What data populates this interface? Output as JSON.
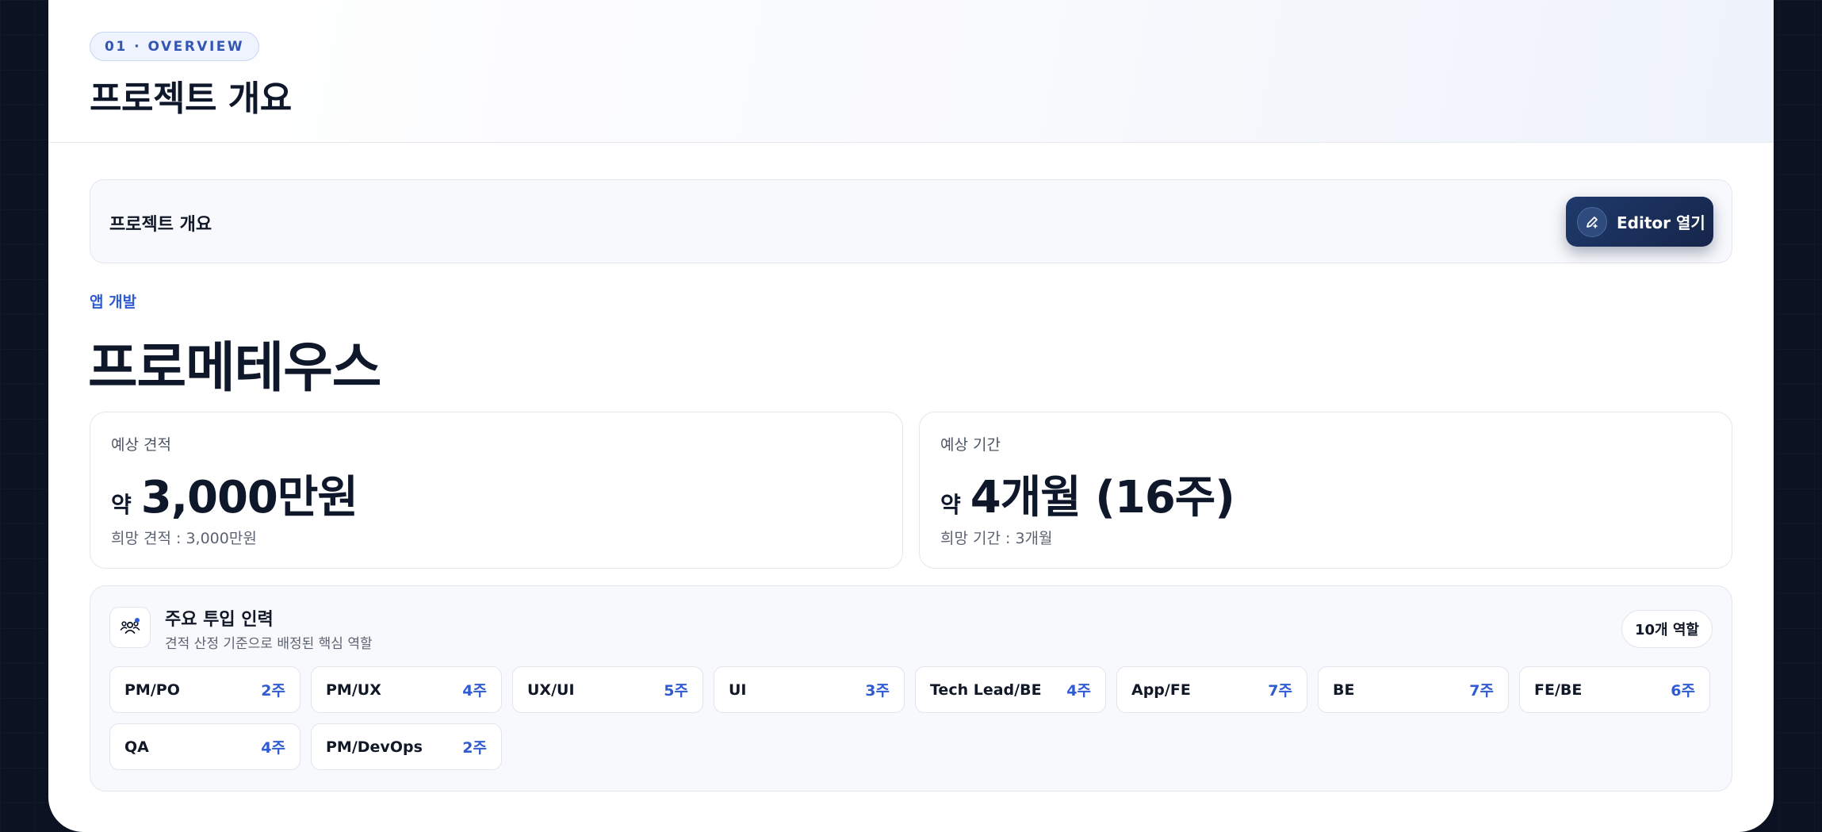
{
  "header": {
    "badge": "01 · OVERVIEW",
    "title": "프로젝트 개요"
  },
  "panel": {
    "label": "프로젝트 개요",
    "editor_button": "Editor 열기"
  },
  "project": {
    "category": "앱 개발",
    "name": "프로메테우스"
  },
  "stats": [
    {
      "label": "예상 견적",
      "prefix": "약",
      "value": "3,000만원",
      "sub": "희망 견적 : 3,000만원"
    },
    {
      "label": "예상 기간",
      "prefix": "약",
      "value": "4개월 (16주)",
      "sub": "희망 기간 : 3개월"
    }
  ],
  "team": {
    "title": "주요 투입 인력",
    "subtitle": "견적 산정 기준으로 배정된 핵심 역할",
    "count": "10개 역할",
    "roles": [
      {
        "name": "PM/PO",
        "duration": "2주"
      },
      {
        "name": "PM/UX",
        "duration": "4주"
      },
      {
        "name": "UX/UI",
        "duration": "5주"
      },
      {
        "name": "UI",
        "duration": "3주"
      },
      {
        "name": "Tech Lead/BE",
        "duration": "4주"
      },
      {
        "name": "App/FE",
        "duration": "7주"
      },
      {
        "name": "BE",
        "duration": "7주"
      },
      {
        "name": "FE/BE",
        "duration": "6주"
      },
      {
        "name": "QA",
        "duration": "4주"
      },
      {
        "name": "PM/DevOps",
        "duration": "2주"
      }
    ]
  },
  "colors": {
    "accent": "#2f5bd3",
    "button_bg": "#1e3a6b",
    "background": "#0b1222"
  },
  "icons": {
    "editor": "pen-edit-icon",
    "team": "team-people-icon"
  }
}
